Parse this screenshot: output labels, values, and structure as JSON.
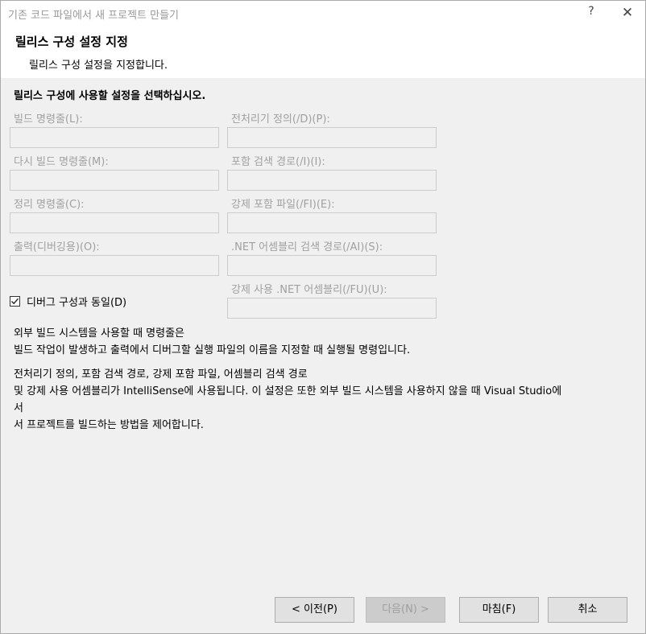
{
  "window": {
    "title": "기존 코드 파일에서 새 프로젝트 만들기",
    "help_glyph": "?",
    "close_glyph": "✕"
  },
  "header": {
    "title": "릴리스 구성 설정 지정",
    "subtitle": "릴리스 구성 설정을 지정합니다."
  },
  "main": {
    "instruction": "릴리스 구성에 사용할 설정을 선택하십시오.",
    "fields": {
      "build_cmd": {
        "label": "빌드 명령줄(L):",
        "value": ""
      },
      "rebuild_cmd": {
        "label": "다시 빌드 명령줄(M):",
        "value": ""
      },
      "clean_cmd": {
        "label": "정리 명령줄(C):",
        "value": ""
      },
      "output": {
        "label": "출력(디버깅용)(O):",
        "value": ""
      },
      "preprocessor": {
        "label": "전처리기 정의(/D)(P):",
        "value": ""
      },
      "include_path": {
        "label": "포함 검색 경로(/I)(I):",
        "value": ""
      },
      "forced_include": {
        "label": "강제 포함 파일(/FI)(E):",
        "value": ""
      },
      "assembly_path": {
        "label": ".NET 어셈블리 검색 경로(/AI)(S):",
        "value": ""
      },
      "forced_using": {
        "label": "강제 사용 .NET 어셈블리(/FU)(U):",
        "value": ""
      }
    },
    "same_as_debug": {
      "label": "디버그 구성과 동일(D)",
      "checked": true
    },
    "description_1": [
      "외부 빌드 시스템을 사용할 때 명령줄은",
      "빌드 작업이 발생하고 출력에서 디버그할 실행 파일의 이름을 지정할 때 실행될 명령입니다."
    ],
    "description_2": [
      "전처리기 정의, 포함 검색 경로, 강제 포함 파일, 어셈블리 검색 경로",
      "및 강제 사용 어셈블리가 IntelliSense에 사용됩니다.  이 설정은 또한 외부 빌드 시스템을 사용하지 않을 때 Visual Studio에",
      "서",
      "서 프로젝트를 빌드하는 방법을 제어합니다."
    ]
  },
  "footer": {
    "prev_label": "< 이전(P)",
    "next_label": "다음(N) >",
    "finish_label": "마침(F)",
    "cancel_label": "취소"
  },
  "colors": {
    "disabled_text": "#a0a0a0",
    "window_bg": "#f0f0f0",
    "header_bg": "#ffffff"
  }
}
